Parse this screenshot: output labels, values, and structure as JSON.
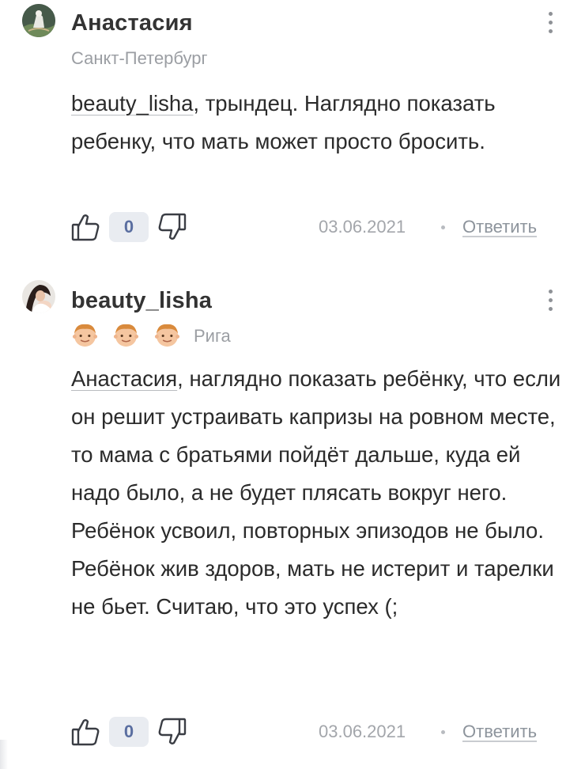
{
  "comments": [
    {
      "author": "Анастасия",
      "city": "Санкт-Петербург",
      "badges": [],
      "paragraphs": [
        {
          "mention": "beauty_lisha",
          "text": ", трындец. Наглядно показать ребенку, что мать может просто бросить."
        }
      ],
      "score": "0",
      "date": "03.06.2021",
      "reply_label": "Ответить",
      "avatar_icon": "avatar-image",
      "like_icon": "thumbs-up-icon",
      "dislike_icon": "thumbs-down-icon"
    },
    {
      "author": "beauty_lisha",
      "city": "Рига",
      "badges": [
        "boy-face-icon",
        "boy-face-icon",
        "boy-face-icon"
      ],
      "paragraphs": [
        {
          "mention": "Анастасия",
          "text": ", наглядно показать ребёнку, что если он решит устраивать капризы на ровном месте, то мама с братьями пойдёт дальше, куда ей надо было, а не будет плясать вокруг него."
        },
        {
          "mention": "",
          "text": "Ребёнок усвоил, повторных эпизодов не было. Ребёнок жив здоров, мать не истерит и тарелки не бьет. Считаю, что это успех (;"
        }
      ],
      "score": "0",
      "date": "03.06.2021",
      "reply_label": "Ответить",
      "avatar_icon": "avatar-image",
      "like_icon": "thumbs-up-icon",
      "dislike_icon": "thumbs-down-icon"
    }
  ],
  "colors": {
    "author": "#333333",
    "text": "#2b2b2b",
    "meta": "#a3a6ab",
    "score_bg": "#e9ecf1",
    "score_text": "#5a6ea0",
    "icon": "#3a3d44"
  }
}
